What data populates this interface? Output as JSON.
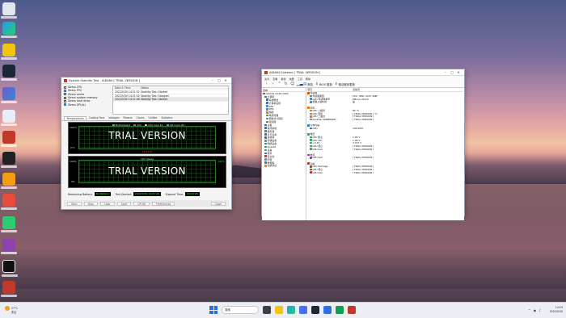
{
  "stability": {
    "title": "System Stability Test - AIDA64 [ TRIAL VERSION ]",
    "checks": [
      {
        "label": "Stress CPU",
        "checked": false
      },
      {
        "label": "Stress FPU",
        "checked": true
      },
      {
        "label": "Stress cache",
        "checked": false
      },
      {
        "label": "Stress system memory",
        "checked": false
      },
      {
        "label": "Stress local disks",
        "checked": false
      },
      {
        "label": "Stress GPU(s)",
        "checked": true
      }
    ],
    "log_header": {
      "date": "Date & Time",
      "status": "Status"
    },
    "log": [
      {
        "date": "2022/5/30 14:21:51",
        "status": "Stability Test: Started"
      },
      {
        "date": "2022/5/30 14:21:52",
        "status": "Stability Test: Stopped"
      },
      {
        "date": "2022/5/30 14:21:46",
        "status": "Stability Test: Started"
      }
    ],
    "tabs": [
      "Temperatures",
      "Cooling Fans",
      "Voltages",
      "Powers",
      "Clocks",
      "Unified",
      "Statistics"
    ],
    "graph1": {
      "legend": [
        "Motherboard",
        "CPU",
        "CPU Core #1",
        "CPU Core #2"
      ],
      "y_top": "100°C",
      "y_bottom": "0°C",
      "watermark": "TRIAL VERSION",
      "time": "14:23:04"
    },
    "graph2": {
      "title": "CPU Usage",
      "y_top": "100%",
      "y_bottom": "0%",
      "right_top": "100%",
      "watermark": "TRIAL VERSION"
    },
    "status": {
      "battery_label": "Remaining Battery:",
      "battery_value": "No Battery",
      "started_label": "Test Started:",
      "started_value": "2022/5/30 14:21:46",
      "elapsed_label": "Elapsed Time:",
      "elapsed_value": "00:00:08"
    },
    "buttons": [
      "Start",
      "Stop",
      "Clear",
      "Save",
      "CPUID",
      "Preferences",
      "Close"
    ]
  },
  "aida": {
    "title": "AIDA64 Extreme [ TRIAL VERSION ]",
    "menu": [
      "文件",
      "查看",
      "报告",
      "收藏",
      "工具",
      "帮助"
    ],
    "toolbar": {
      "report": "报告",
      "bios": "BIOS 更新",
      "driver": "驱动程序更新"
    },
    "tree_header": "菜单",
    "tree": [
      {
        "label": "AIDA64 v6.60.5900",
        "color": "#c0392b"
      },
      {
        "label": "计算机",
        "color": "#2b72c9"
      },
      {
        "label": "系统概述",
        "color": "#2b72c9"
      },
      {
        "label": "计算机名称",
        "color": "#2b72c9"
      },
      {
        "label": "DMI",
        "color": "#3a8ad6"
      },
      {
        "label": "IPMI",
        "color": "#3a8ad6"
      },
      {
        "label": "超频",
        "color": "#e07a1f"
      },
      {
        "label": "电源管理",
        "color": "#3aa04a"
      },
      {
        "label": "便携式计算机",
        "color": "#3a8ad6"
      },
      {
        "label": "传感器",
        "color": "#d35400"
      },
      {
        "label": "主板",
        "color": "#2b72c9"
      },
      {
        "label": "操作系统",
        "color": "#1a73e8"
      },
      {
        "label": "服务器",
        "color": "#607d8b"
      },
      {
        "label": "显示设备",
        "color": "#1a73e8"
      },
      {
        "label": "多媒体",
        "color": "#8e44ad"
      },
      {
        "label": "存储设备",
        "color": "#7f8c8d"
      },
      {
        "label": "网络设备",
        "color": "#16a085"
      },
      {
        "label": "DirectX",
        "color": "#27ae60"
      },
      {
        "label": "设备",
        "color": "#7f8c8d"
      },
      {
        "label": "软件",
        "color": "#2b72c9"
      },
      {
        "label": "安全性",
        "color": "#c0392b"
      },
      {
        "label": "配置",
        "color": "#7f8c8d"
      },
      {
        "label": "数据库",
        "color": "#2980b9"
      },
      {
        "label": "性能测试",
        "color": "#e67e22"
      }
    ],
    "columns": {
      "field": "项目",
      "value": "当前值"
    },
    "rows": [
      {
        "field": "传感器",
        "value": "",
        "group": true,
        "color": "#d35400"
      },
      {
        "field": "传感器类型",
        "value": "CPU, HDD, ACPI, SNB",
        "color": "#3a8ad6"
      },
      {
        "field": "GPU 传感器类型",
        "value": "PMLog (ADL2)",
        "color": "#3a8ad6"
      },
      {
        "field": "机箱入侵检测",
        "value": "是",
        "color": "#3a8ad6"
      },
      {
        "field": "",
        "value": ""
      },
      {
        "field": "温度",
        "value": "",
        "group": true,
        "color": "#e07a1f"
      },
      {
        "field": "CPU 二极管",
        "value": "85 °C",
        "color": "#e07a1f"
      },
      {
        "field": "CPU 封装",
        "value": "[ TRIAL VERSION ] °C",
        "color": "#e07a1f"
      },
      {
        "field": "GPU 二极管",
        "value": "[ TRIAL VERSION ]",
        "color": "#e07a1f"
      },
      {
        "field": "SanDisk SDBB8QEH...",
        "value": "[ TRIAL VERSION ]",
        "color": "#7f8c8d"
      },
      {
        "field": "",
        "value": ""
      },
      {
        "field": "冷却风扇",
        "value": "",
        "group": true,
        "color": "#2980b9"
      },
      {
        "field": "GPU",
        "value": "342 RPM",
        "color": "#2980b9"
      },
      {
        "field": "",
        "value": ""
      },
      {
        "field": "电压",
        "value": "",
        "group": true,
        "color": "#27ae60"
      },
      {
        "field": "CPU 核心",
        "value": "1.05 V",
        "color": "#27ae60"
      },
      {
        "field": "CPU VID",
        "value": "1.08 V",
        "color": "#27ae60"
      },
      {
        "field": "+3.3V",
        "value": "3.337 V",
        "color": "#27ae60"
      },
      {
        "field": "GPU 核心",
        "value": "[ TRIAL VERSION ]",
        "color": "#27ae60"
      },
      {
        "field": "GPU SoC",
        "value": "[ TRIAL VERSION ]",
        "color": "#27ae60"
      },
      {
        "field": "",
        "value": ""
      },
      {
        "field": "电流",
        "value": "",
        "group": true,
        "color": "#8e44ad"
      },
      {
        "field": "GPU SoC",
        "value": "[ TRIAL VERSION ]",
        "color": "#8e44ad"
      },
      {
        "field": "",
        "value": ""
      },
      {
        "field": "功耗",
        "value": "",
        "group": true,
        "color": "#c0392b"
      },
      {
        "field": "CPU Package",
        "value": "[ TRIAL VERSION ]",
        "color": "#c0392b"
      },
      {
        "field": "GPU 核心",
        "value": "[ TRIAL VERSION ]",
        "color": "#c0392b"
      },
      {
        "field": "GPU SoC",
        "value": "[ TRIAL VERSION ]",
        "color": "#c0392b"
      }
    ]
  },
  "taskbar": {
    "weather_temp": "27°C",
    "weather_desc": "多云",
    "search": "搜索",
    "time": "14:23",
    "date": "2022/5/30"
  }
}
